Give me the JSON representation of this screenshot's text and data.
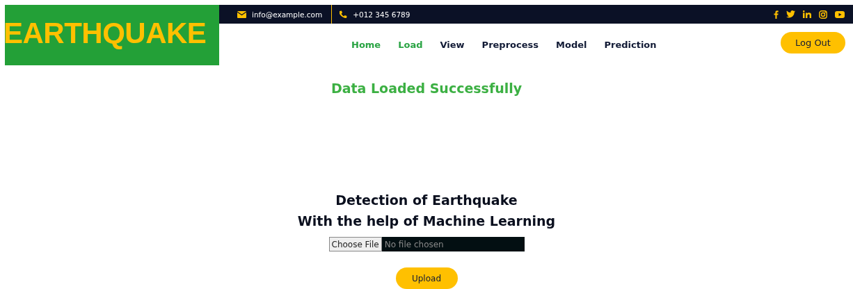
{
  "logo": {
    "text": "EARTHQUAKE"
  },
  "topbar": {
    "email": "info@example.com",
    "phone": "+012 345 6789"
  },
  "nav": [
    {
      "label": "Home",
      "selected": true
    },
    {
      "label": "Load",
      "selected": true
    },
    {
      "label": "View",
      "selected": false
    },
    {
      "label": "Preprocess",
      "selected": false
    },
    {
      "label": "Model",
      "selected": false
    },
    {
      "label": "Prediction",
      "selected": false
    }
  ],
  "logout_button": "Log Out",
  "status_message": "Data Loaded Successfully",
  "heading": [
    "Detection of Earthquake",
    "With the help of Machine Learning"
  ],
  "file_input": {
    "button": "Choose File",
    "value": "No file chosen"
  },
  "upload_button": "Upload"
}
